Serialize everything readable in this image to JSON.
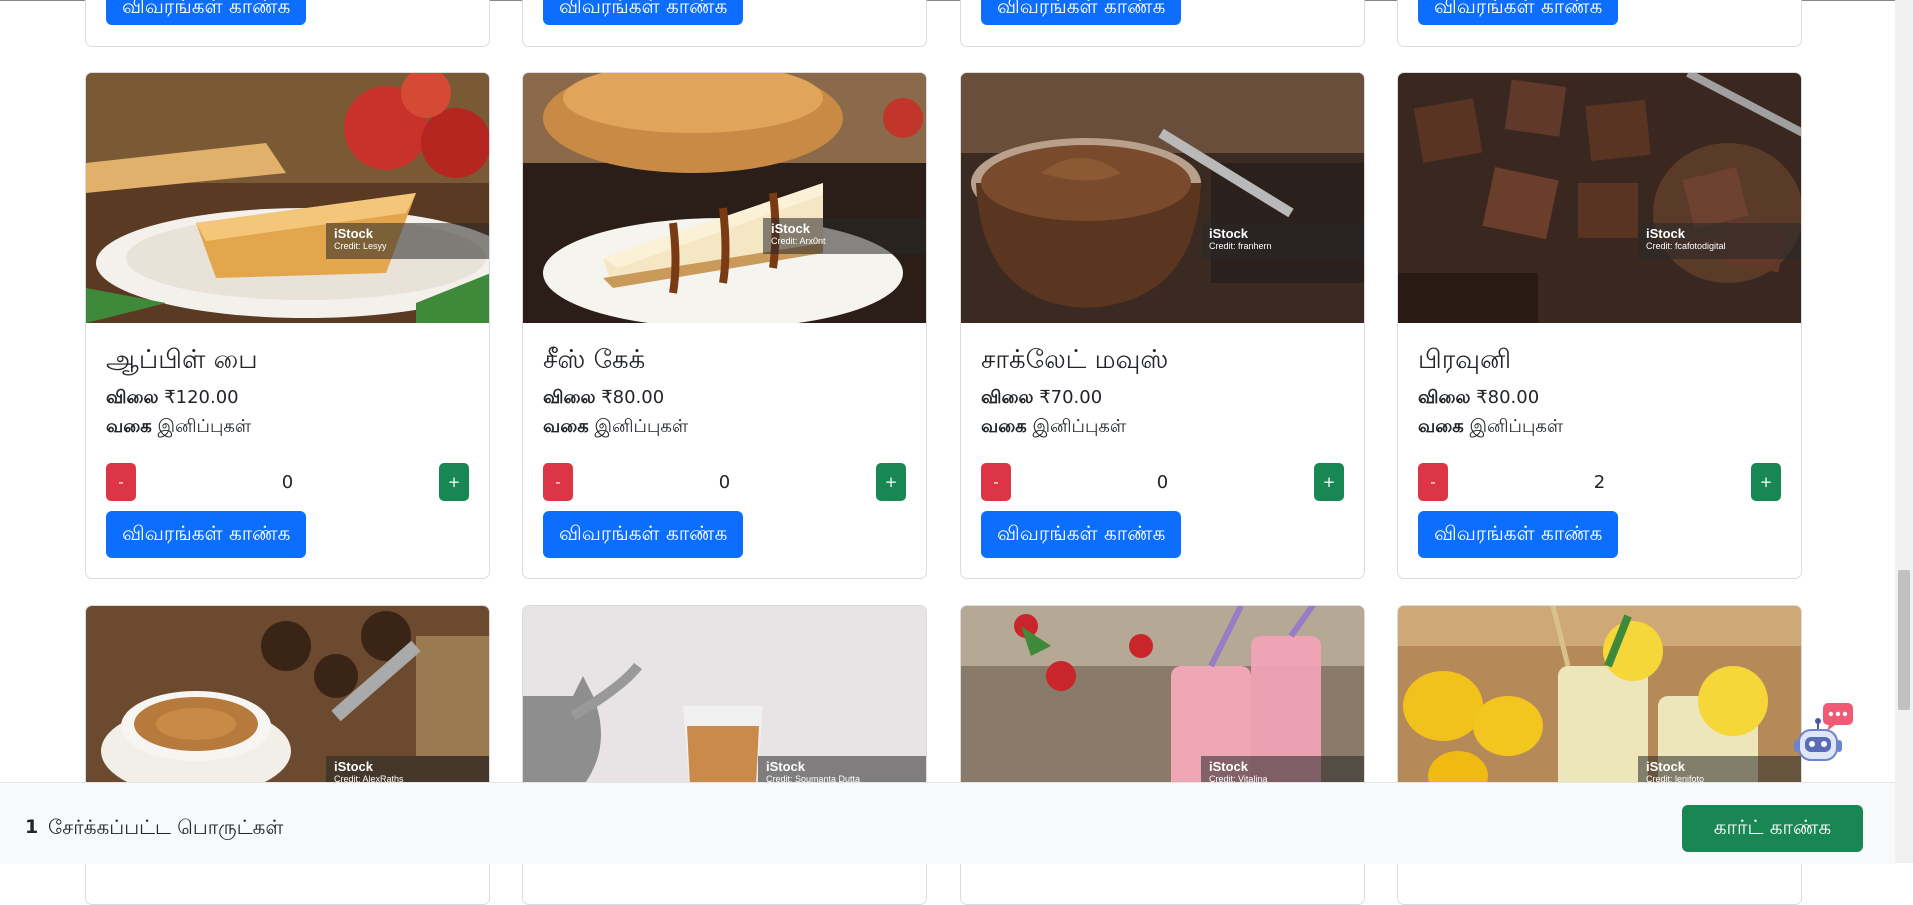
{
  "products_row1": [
    {
      "name": "ஆப்பிள் பை",
      "price_label": "விலை",
      "price": "₹120.00",
      "category_label": "வகை",
      "category": "இனிப்புகள்",
      "quantity": "0",
      "minus": "-",
      "plus": "+",
      "details": "விவரங்கள் காண்க",
      "stock_brand": "iStock",
      "stock_credit": "Credit: Lesyy"
    },
    {
      "name": "சீஸ் கேக்",
      "price_label": "விலை",
      "price": "₹80.00",
      "category_label": "வகை",
      "category": "இனிப்புகள்",
      "quantity": "0",
      "minus": "-",
      "plus": "+",
      "details": "விவரங்கள் காண்க",
      "stock_brand": "iStock",
      "stock_credit": "Credit: Arx0nt"
    },
    {
      "name": "சாக்லேட் மவுஸ்",
      "price_label": "விலை",
      "price": "₹70.00",
      "category_label": "வகை",
      "category": "இனிப்புகள்",
      "quantity": "0",
      "minus": "-",
      "plus": "+",
      "details": "விவரங்கள் காண்க",
      "stock_brand": "iStock",
      "stock_credit": "Credit: franhern"
    },
    {
      "name": "பிரவுனி",
      "price_label": "விலை",
      "price": "₹80.00",
      "category_label": "வகை",
      "category": "இனிப்புகள்",
      "quantity": "2",
      "minus": "-",
      "plus": "+",
      "details": "விவரங்கள் காண்க",
      "stock_brand": "iStock",
      "stock_credit": "Credit: fcafotodigital"
    }
  ],
  "products_row2": [
    {
      "stock_brand": "iStock",
      "stock_credit": "Credit: AlexRaths"
    },
    {
      "stock_brand": "iStock",
      "stock_credit": "Credit: Soumanta Dutta"
    },
    {
      "stock_brand": "iStock",
      "stock_credit": "Credit: Vitalina"
    },
    {
      "stock_brand": "iStock",
      "stock_credit": "Credit: lenifoto"
    }
  ],
  "top_partial_buttons": [
    "விவரங்கள் காண்க",
    "விவரங்கள் காண்க",
    "விவரங்கள் காண்க",
    "விவரங்கள் காண்க"
  ],
  "footer": {
    "count": "1",
    "label": "சேர்க்கப்பட்ட பொருட்கள்",
    "cart_button": "கார்ட் காண்க"
  },
  "colors": {
    "primary": "#0d6efd",
    "danger": "#dc3545",
    "success": "#198754"
  },
  "icons": {
    "chatbot": "robot-chat-icon"
  }
}
